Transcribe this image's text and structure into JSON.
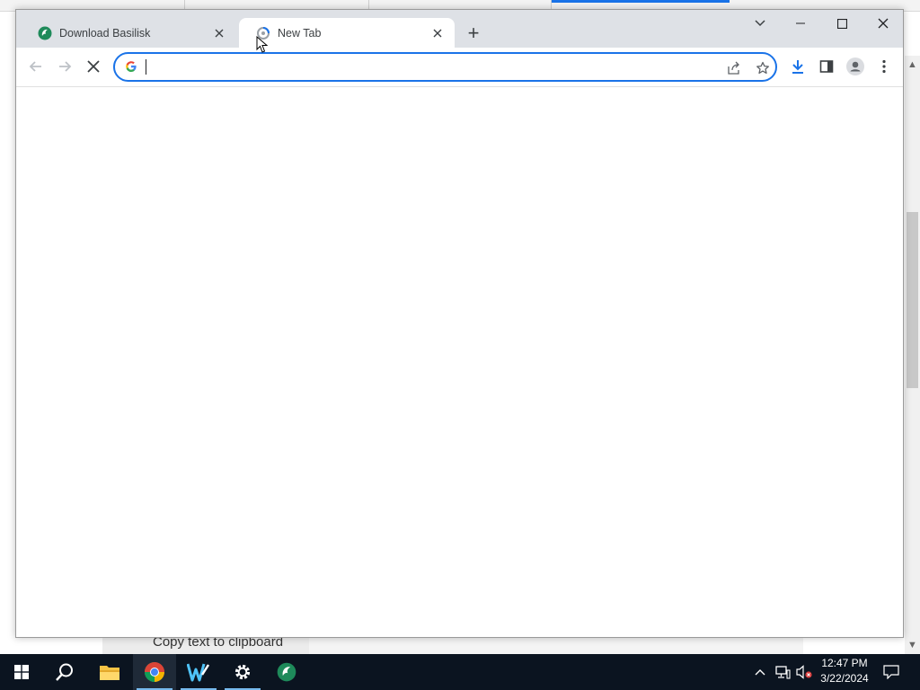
{
  "background": {
    "copy_label": "Copy text to clipboard"
  },
  "browser": {
    "tabs": [
      {
        "title": "Download Basilisk",
        "active": false,
        "favicon": "basilisk-icon"
      },
      {
        "title": "New Tab",
        "active": true,
        "favicon": "loading-spinner-icon"
      }
    ],
    "new_tab_label": "+",
    "omnibox": {
      "value": "",
      "placeholder": "",
      "search_engine_icon": "google-g-icon"
    },
    "accent_color": "#1a73e8"
  },
  "taskbar": {
    "apps": [
      "start-icon",
      "search-icon",
      "file-explorer-icon",
      "chrome-icon",
      "w-app-icon",
      "settings-icon",
      "basilisk-icon"
    ],
    "clock": {
      "time": "12:47 PM",
      "date": "3/22/2024"
    }
  }
}
